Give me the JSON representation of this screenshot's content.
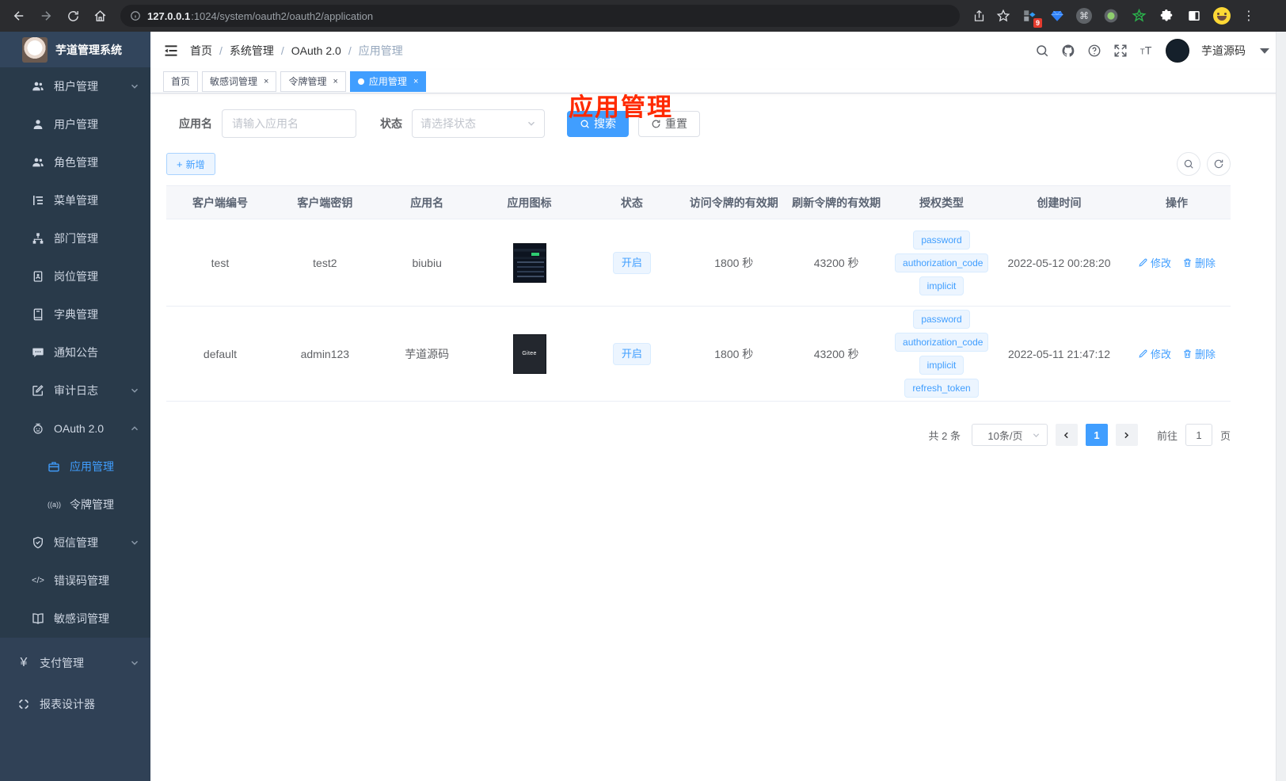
{
  "browser": {
    "url_host": "127.0.0.1",
    "url_path": ":1024/system/oauth2/oauth2/application",
    "extension_badge": "9"
  },
  "sidebar": {
    "logo_title": "芋道管理系统",
    "items": [
      {
        "label": "租户管理"
      },
      {
        "label": "用户管理"
      },
      {
        "label": "角色管理"
      },
      {
        "label": "菜单管理"
      },
      {
        "label": "部门管理"
      },
      {
        "label": "岗位管理"
      },
      {
        "label": "字典管理"
      },
      {
        "label": "通知公告"
      },
      {
        "label": "审计日志"
      },
      {
        "label": "OAuth 2.0"
      },
      {
        "label": "应用管理"
      },
      {
        "label": "令牌管理"
      },
      {
        "label": "短信管理"
      },
      {
        "label": "错误码管理"
      },
      {
        "label": "敏感词管理"
      }
    ],
    "bottom_items": [
      {
        "label": "支付管理"
      },
      {
        "label": "报表设计器"
      }
    ],
    "icons": {
      "pay": "¥",
      "error_code": "</>",
      "token": "((a))"
    }
  },
  "header": {
    "breadcrumb": [
      "首页",
      "系统管理",
      "OAuth 2.0",
      "应用管理"
    ],
    "username": "芋道源码"
  },
  "annotation": {
    "text": "应用管理"
  },
  "tabs": [
    {
      "label": "首页"
    },
    {
      "label": "敏感词管理"
    },
    {
      "label": "令牌管理"
    },
    {
      "label": "应用管理"
    }
  ],
  "filters": {
    "app_name_label": "应用名",
    "app_name_placeholder": "请输入应用名",
    "status_label": "状态",
    "status_placeholder": "请选择状态",
    "search_label": "搜索",
    "reset_label": "重置",
    "add_label": "新增"
  },
  "table": {
    "columns": [
      "客户端编号",
      "客户端密钥",
      "应用名",
      "应用图标",
      "状态",
      "访问令牌的有效期",
      "刷新令牌的有效期",
      "授权类型",
      "创建时间",
      "操作"
    ],
    "edit_label": "修改",
    "delete_label": "删除",
    "rows": [
      {
        "client_id": "test",
        "secret": "test2",
        "name": "biubiu",
        "status": "开启",
        "access": "1800 秒",
        "refresh": "43200 秒",
        "grants": [
          "password",
          "authorization_code",
          "implicit"
        ],
        "created": "2022-05-12 00:28:20"
      },
      {
        "client_id": "default",
        "secret": "admin123",
        "name": "芋道源码",
        "icon_label": "Gitee",
        "status": "开启",
        "access": "1800 秒",
        "refresh": "43200 秒",
        "grants": [
          "password",
          "authorization_code",
          "implicit",
          "refresh_token"
        ],
        "created": "2022-05-11 21:47:12"
      }
    ]
  },
  "pagination": {
    "total": "共 2 条",
    "page_size": "10条/页",
    "current_page": "1",
    "goto_label": "前往",
    "goto_value": "1",
    "page_label": "页"
  }
}
